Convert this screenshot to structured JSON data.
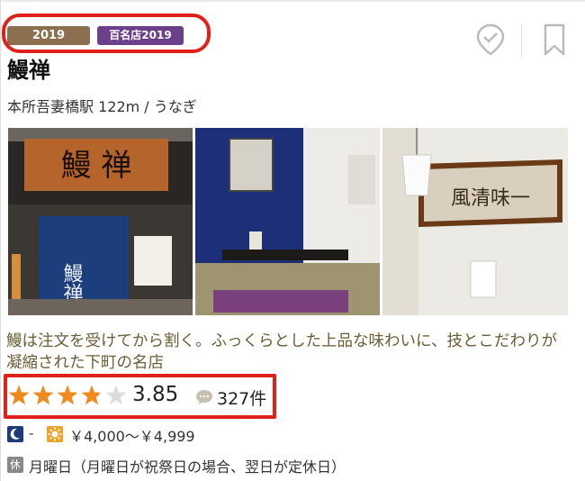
{
  "badges": {
    "award": "2019 Bronze",
    "hyakumeiten": "百名店2019"
  },
  "restaurant": {
    "name": "鰻禅",
    "location_genre": "本所吾妻橋駅 122m / うなぎ",
    "catchphrase": "鰻は注文を受けてから割く。ふっくらとした上品な味わいに、技とこだわりが凝縮された下町の名店"
  },
  "photos": [
    {
      "sign_text": "鰻 禅",
      "noren_text": "鰻禅"
    },
    {
      "sign_text": ""
    },
    {
      "sign_text": "風清味一"
    }
  ],
  "rating": {
    "score": "3.85",
    "score_value": 3.85,
    "max_stars": 5,
    "review_count": "327件"
  },
  "budget": {
    "dinner": "-",
    "lunch": "￥4,000～￥4,999"
  },
  "holiday": {
    "label": "休",
    "text": "月曜日（月曜日が祝祭日の場合、翌日が定休日）"
  },
  "icons": {
    "save": "checkmark-pin-icon",
    "bookmark": "bookmark-icon",
    "review": "speech-bubble-icon",
    "dinner": "moon-icon",
    "lunch": "sun-icon"
  },
  "colors": {
    "highlight": "#e0211a",
    "bronze_badge": "#8b6f4e",
    "hyakumeiten_badge": "#6c3f8a",
    "star_fill": "#f08a1c",
    "catch_text": "#6b5e34"
  }
}
